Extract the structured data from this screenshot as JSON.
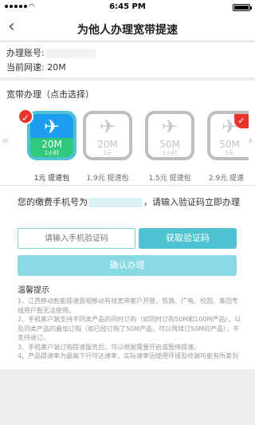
{
  "status": {
    "time": "6:45 PM",
    "wifi_icon": "wifi-icon"
  },
  "nav": {
    "title": "为他人办理宽带提速",
    "back_icon": "‹"
  },
  "account": {
    "number_label": "办理账号:",
    "speed_label": "当前网速: 20M"
  },
  "packages": {
    "section_title": "宽带办理（点击选择）",
    "items": [
      {
        "speed": "20M",
        "duration": "1小时",
        "label": "1元 提速包",
        "selected": true
      },
      {
        "speed": "20M",
        "duration": "1天",
        "label": "1.9元 提速包",
        "selected": false
      },
      {
        "speed": "50M",
        "duration": "1小时",
        "label": "1.5元 提速包",
        "selected": false
      },
      {
        "speed": "50M",
        "duration": "1天",
        "label": "2.9元 提速",
        "selected": false
      }
    ]
  },
  "verify": {
    "prompt_prefix": "您的缴费手机号为",
    "prompt_suffix": "，请输入验证码立即办理",
    "code_placeholder": "请输入手机验证码",
    "get_code_label": "获取验证码",
    "confirm_label": "确认办理"
  },
  "tips": {
    "title": "温馨提示",
    "items": [
      "1、江西移动智能提速面相移动有线宽带客户开放，铁路、广电、校园、集团专线用户暂无法使用。",
      "2、手机客户端支持不同类产品的同时订购（如同时订购50M和100M产品），以及同类产品的叠加订购（如已经订购了50M产品，可以再续订50M的产品），不支持退订。",
      "3、手机客户端订购提速服务后，可以根据需要开启或暂停提速。",
      "4、产品提速率为最高下行可达速率，实际速率因使用环境及终端可能有所差别"
    ]
  },
  "colors": {
    "accent": "#4fc3d2",
    "selected_blue": "#1e9ef0",
    "selected_green": "#30c87a",
    "badge_red": "#e8322c"
  }
}
